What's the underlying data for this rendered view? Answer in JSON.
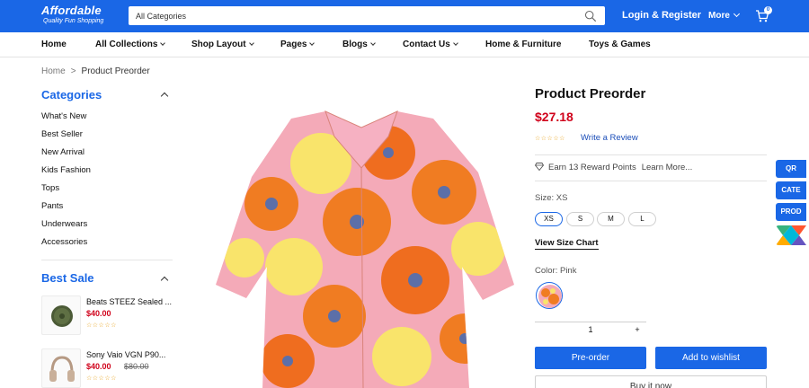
{
  "header": {
    "logo_name": "Affordable",
    "logo_tagline": "Quality Fun Shopping",
    "search_placeholder": "All Categories",
    "login_label": "Login & Register",
    "more_label": "More",
    "cart_count": "0"
  },
  "nav": {
    "items": [
      {
        "label": "Home"
      },
      {
        "label": "All Collections"
      },
      {
        "label": "Shop Layout"
      },
      {
        "label": "Pages"
      },
      {
        "label": "Blogs"
      },
      {
        "label": "Contact Us"
      },
      {
        "label": "Home & Furniture"
      },
      {
        "label": "Toys & Games"
      }
    ]
  },
  "breadcrumb": {
    "home": "Home",
    "separator": ">",
    "current": "Product Preorder"
  },
  "sidebar": {
    "categories_title": "Categories",
    "categories": [
      "What's New",
      "Best Seller",
      "New Arrival",
      "Kids Fashion",
      "Tops",
      "Pants",
      "Underwears",
      "Accessories"
    ],
    "best_sale_title": "Best Sale",
    "best_sale": [
      {
        "title": "Beats STEEZ Sealed ...",
        "price": "$40.00",
        "old_price": "",
        "rating": "☆☆☆☆☆"
      },
      {
        "title": "Sony Vaio VGN P90...",
        "price": "$40.00",
        "old_price": "$80.00",
        "rating": "☆☆☆☆☆"
      }
    ]
  },
  "product": {
    "title": "Product Preorder",
    "price": "$27.18",
    "rating": "☆☆☆☆☆",
    "review_link": "Write a Review",
    "reward_text": "Earn 13 Reward Points",
    "reward_link": "Learn More...",
    "size_label": "Size: XS",
    "sizes": [
      "XS",
      "S",
      "M",
      "L"
    ],
    "selected_size": "XS",
    "size_chart_link": "View Size Chart",
    "color_label": "Color: Pink",
    "quantity": "1",
    "qty_plus": "+",
    "preorder_label": "Pre-order",
    "wishlist_label": "Add to wishlist",
    "buy_now_label": "Buy it now"
  },
  "side_tabs": [
    "QR",
    "CATE",
    "PROD"
  ],
  "colors": {
    "brand_blue": "#1a67e6",
    "price_red": "#d0021b",
    "star_gold": "#e8a21a"
  },
  "icons": [
    "search-icon",
    "cart-icon",
    "chevron-down-icon",
    "chevron-up-icon",
    "diamond-icon"
  ]
}
